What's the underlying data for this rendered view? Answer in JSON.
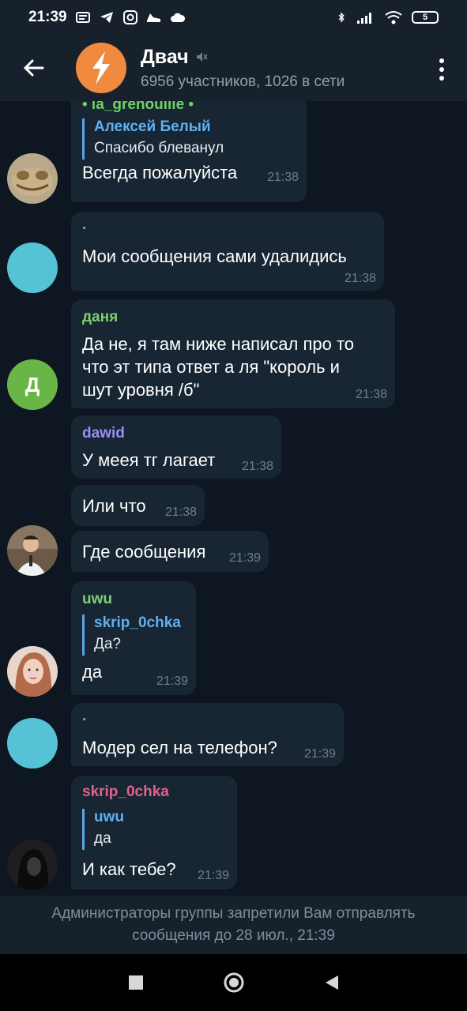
{
  "statusbar": {
    "time": "21:39",
    "battery": "5"
  },
  "header": {
    "title": "Двач",
    "subtitle": "6956 участников, 1026 в сети"
  },
  "messages": [
    {
      "sender": "• la_grenouille •",
      "sender_color": "#6fd163",
      "reply_name": "Алексей Белый",
      "reply_text": "Спасибо блеванул",
      "text": "Всегда пожалуйста",
      "time": "21:38"
    },
    {
      "sender": ".",
      "sender_color": "#4fc3c9",
      "text": "Мои сообщения сами удалидись",
      "time": "21:38"
    },
    {
      "sender": "даня",
      "sender_color": "#7ed16f",
      "text_lines": [
        "Да не, я там ниже написал про то",
        "что эт типа ответ а ля \"король и",
        "шут уровня /б\""
      ],
      "time": "21:38",
      "avatar_letter": "Д"
    },
    {
      "sender": "dawid",
      "sender_color": "#9b8ff0",
      "text": "У меея тг лагает",
      "time": "21:38"
    },
    {
      "text": "Или что",
      "time": "21:38"
    },
    {
      "text": "Где сообщения",
      "time": "21:39"
    },
    {
      "sender": "uwu",
      "sender_color": "#7ed16f",
      "reply_name": "skrip_0chka",
      "reply_text": "Да?",
      "text": "да",
      "time": "21:39"
    },
    {
      "sender": ".",
      "sender_color": "#4fc3c9",
      "text": "Модер сел на телефон?",
      "time": "21:39"
    },
    {
      "sender": "skrip_0chka",
      "sender_color": "#e0638a",
      "reply_name": "uwu",
      "reply_text": "да",
      "text": "И как тебе?",
      "time": "21:39"
    }
  ],
  "footer": {
    "line1": "Администраторы группы запретили Вам отправлять",
    "line2": "сообщения до 28 июл., 21:39"
  },
  "colors": {
    "background": "#0e1621",
    "bubble": "#182533",
    "bar": "#17212b",
    "avatar_orange": "#f08a3e",
    "avatar_cyan": "#56c2d6",
    "avatar_green": "#6ab547"
  }
}
